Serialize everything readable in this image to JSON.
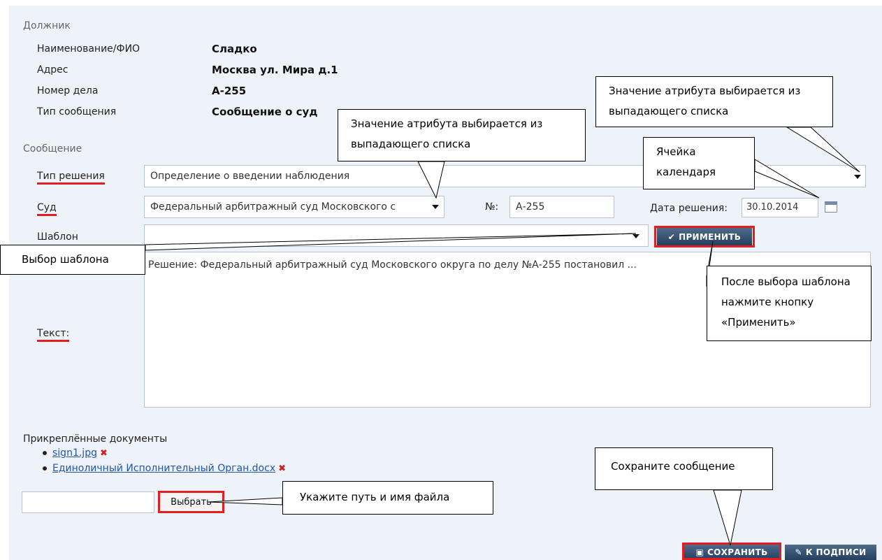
{
  "debtor": {
    "section_title": "Должник",
    "rows": [
      {
        "label": "Наименование/ФИО",
        "value": "Сладко"
      },
      {
        "label": "Адрес",
        "value": "Москва ул. Мира д.1"
      },
      {
        "label": "Номер дела",
        "value": "А-255"
      },
      {
        "label": "Тип сообщения",
        "value": "Сообщение о суд"
      }
    ]
  },
  "message": {
    "section_title": "Сообщение",
    "decision_type_label": "Тип решения",
    "decision_type_value": "Определение о введении наблюдения",
    "court_label": "Суд",
    "court_value": "Федеральный арбитражный суд Московского с",
    "number_label": "№:",
    "number_value": "А-255",
    "decision_date_label": "Дата решения:",
    "decision_date_value": "30.10.2014",
    "template_label": "Шаблон",
    "template_value": "",
    "apply_button": "ПРИМЕНИТЬ",
    "text_label": "Текст:",
    "text_value": "Решение: Федеральный арбитражный суд Московского округа по делу №А-255 постановил ..."
  },
  "attachments": {
    "title": "Прикреплённые документы",
    "files": [
      {
        "name": "sign1.jpg"
      },
      {
        "name": "Единоличный Исполнительный Орган.docx"
      }
    ],
    "file_input_value": "",
    "choose_button": "Выбрать"
  },
  "actions": {
    "save_button": "СОХРАНИТЬ",
    "sign_button": "К ПОДПИСИ"
  },
  "callouts": {
    "dropdown_top": "Значение атрибута выбирается из выпадающего списка",
    "dropdown_court": "Значение атрибута выбирается из выпадающего списка",
    "calendar": "Ячейка календаря",
    "template_choice": "Выбор шаблона",
    "apply_hint": "После выбора шаблона нажмите кнопку «Применить»",
    "file_path": "Укажите путь и имя файла",
    "save_hint": "Сохраните сообщение"
  },
  "colors": {
    "panel_bg": "#eef2f9",
    "highlight": "#e02020",
    "button_dark": "#24405e",
    "link": "#2255aa"
  }
}
